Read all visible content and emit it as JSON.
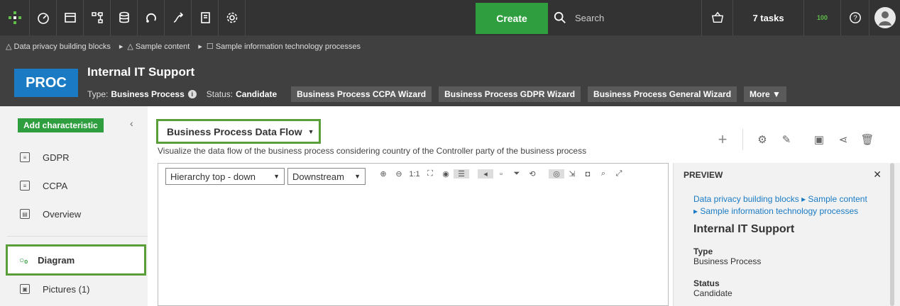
{
  "topbar": {
    "create_label": "Create",
    "search_placeholder": "Search",
    "tasks_label": "7 tasks",
    "notifications_count": "100"
  },
  "breadcrumb": {
    "items": [
      "Data privacy building blocks",
      "Sample content",
      "Sample information technology processes"
    ]
  },
  "asset": {
    "badge": "PROC",
    "title": "Internal IT Support",
    "type_label": "Type:",
    "type_value": "Business Process",
    "status_label": "Status:",
    "status_value": "Candidate",
    "wizards": [
      "Business Process CCPA Wizard",
      "Business Process GDPR Wizard",
      "Business Process General Wizard"
    ],
    "more_label": "More"
  },
  "sidebar": {
    "add_label": "Add characteristic",
    "items": [
      {
        "label": "GDPR",
        "icon": "page-icon"
      },
      {
        "label": "CCPA",
        "icon": "page-icon"
      },
      {
        "label": "Overview",
        "icon": "overview-icon"
      },
      {
        "label": "Diagram",
        "icon": "diagram-icon"
      },
      {
        "label": "Pictures (1)",
        "icon": "pictures-icon"
      }
    ]
  },
  "main": {
    "view_selector": "Business Process Data Flow",
    "description": "Visualize the data flow of the business process considering country of the Controller party of the business process",
    "layout_select": "Hierarchy top - down",
    "direction_select": "Downstream",
    "zoom_label": "1:1"
  },
  "preview": {
    "heading": "PREVIEW",
    "crumb_line1": "Data privacy building blocks ▸ Sample content",
    "crumb_line2": "▸ Sample information technology processes",
    "title": "Internal IT Support",
    "type_label": "Type",
    "type_value": "Business Process",
    "status_label": "Status",
    "status_value": "Candidate"
  },
  "colors": {
    "topbar": "#333333",
    "header": "#404040",
    "accent_green": "#2f9e3f",
    "highlight_green": "#5a9e3a",
    "proc_blue": "#1a7bc4"
  }
}
